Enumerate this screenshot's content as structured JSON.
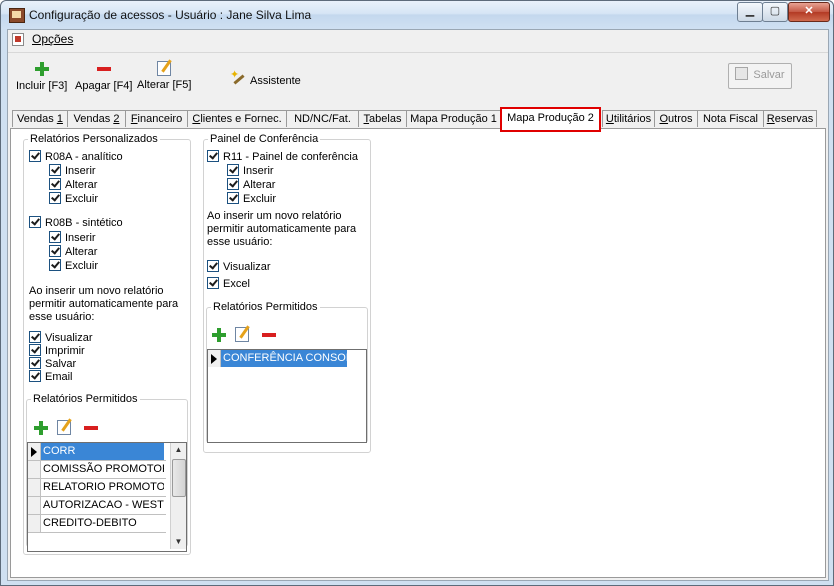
{
  "window": {
    "title": "Configuração de acessos - Usuário : Jane Silva Lima",
    "min": "▁",
    "max": "▢",
    "close": "✕"
  },
  "menu": {
    "options": "Opções"
  },
  "toolbar": {
    "insert": "Incluir [F3]",
    "delete": "Apagar [F4]",
    "edit": "Alterar [F5]",
    "assistant": "Assistente",
    "save": "Salvar"
  },
  "tabs": [
    {
      "pre": "Vendas ",
      "u": "1",
      "post": ""
    },
    {
      "pre": "Vendas ",
      "u": "2",
      "post": ""
    },
    {
      "pre": "",
      "u": "F",
      "post": "inanceiro"
    },
    {
      "pre": "",
      "u": "C",
      "post": "lientes e Fornec."
    },
    {
      "pre": "ND/NC/Fat.",
      "u": "",
      "post": ""
    },
    {
      "pre": "",
      "u": "T",
      "post": "abelas"
    },
    {
      "pre": "Mapa Produção 1",
      "u": "",
      "post": ""
    },
    {
      "pre": "Mapa Produção 2",
      "u": "",
      "post": ""
    },
    {
      "pre": "",
      "u": "U",
      "post": "tilitários"
    },
    {
      "pre": "",
      "u": "O",
      "post": "utros"
    },
    {
      "pre": "Nota Fiscal",
      "u": "",
      "post": ""
    },
    {
      "pre": "",
      "u": "R",
      "post": "eservas"
    }
  ],
  "left": {
    "group_title": "Relatórios Personalizados",
    "r08a": "R08A - analítico",
    "r08b": "R08B - sintético",
    "insert": "Inserir",
    "alter": "Alterar",
    "delete": "Excluir",
    "note": "Ao inserir um novo relatório permitir automaticamente para esse usuário:",
    "view": "Visualizar",
    "print": "Imprimir",
    "save": "Salvar",
    "email": "Email",
    "permitted_title": "Relatórios Permitidos",
    "permitted_rows": [
      "CORR",
      "COMISSÃO PROMOTOR",
      "RELATORIO PROMOTOR",
      "AUTORIZACAO - WEST",
      "CREDITO-DEBITO"
    ]
  },
  "right": {
    "group_title": "Painel de Conferência",
    "r11": "R11 - Painel de conferência",
    "insert": "Inserir",
    "alter": "Alterar",
    "delete": "Excluir",
    "note": "Ao inserir um novo relatório permitir automaticamente para esse usuário:",
    "view": "Visualizar",
    "excel": "Excel",
    "permitted_title": "Relatórios Permitidos",
    "permitted_rows": [
      "CONFERÊNCIA CONSOL"
    ]
  },
  "colors": {
    "selection": "#3a86d6",
    "active_tab_border": "#e00000",
    "plus": "#2e9e2e",
    "minus": "#d81f1f"
  }
}
